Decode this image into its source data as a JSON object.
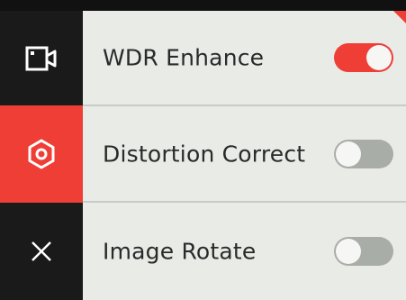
{
  "sidebar": {
    "items": [
      {
        "icon": "video-camera-icon",
        "active": false
      },
      {
        "icon": "lens-settings-icon",
        "active": true
      },
      {
        "icon": "close-icon",
        "active": false
      }
    ]
  },
  "settings": {
    "rows": [
      {
        "label": "WDR Enhance",
        "enabled": true
      },
      {
        "label": "Distortion Correct",
        "enabled": false
      },
      {
        "label": "Image Rotate",
        "enabled": false
      }
    ]
  },
  "colors": {
    "accent": "#ef3e36",
    "panel": "#e9ebe7",
    "sidebar": "#1a1a1a",
    "toggle_off": "#a9ada8"
  }
}
